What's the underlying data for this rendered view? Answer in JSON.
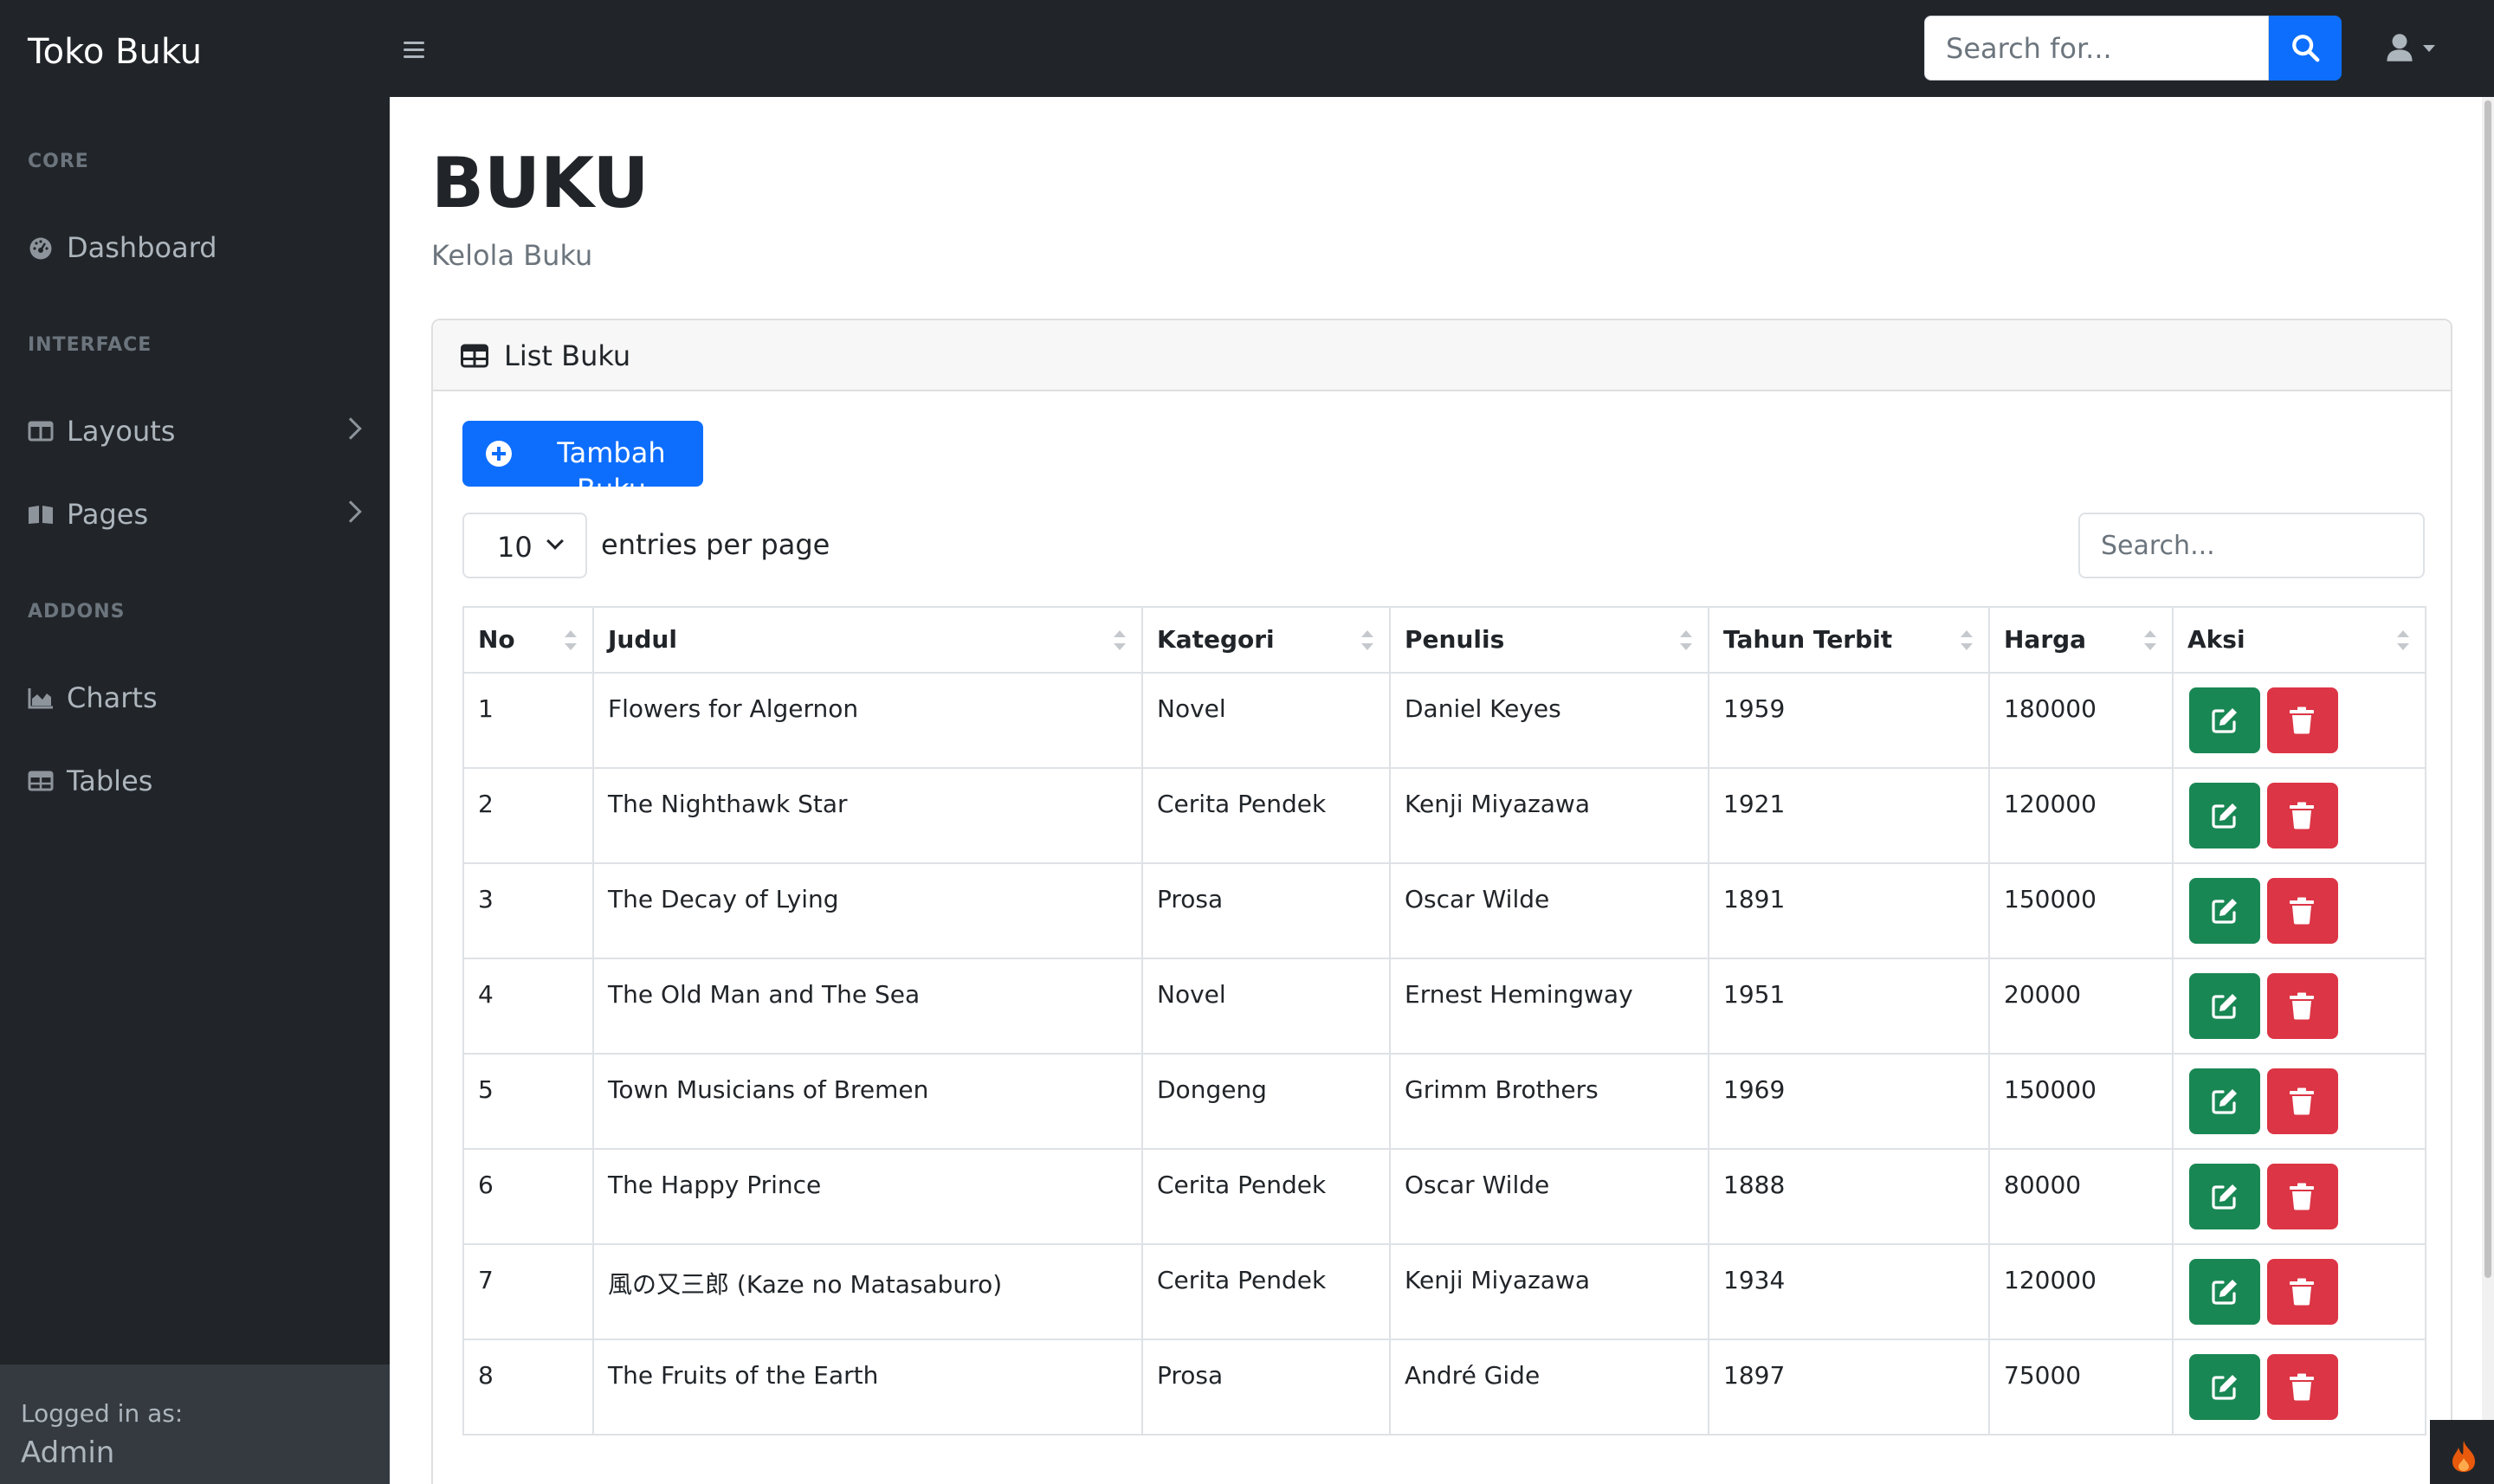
{
  "navbar": {
    "brand": "Toko Buku",
    "search_placeholder": "Search for..."
  },
  "sidebar": {
    "sections": [
      {
        "heading": "CORE",
        "items": [
          {
            "label": "Dashboard",
            "icon": "tachometer-icon"
          }
        ]
      },
      {
        "heading": "INTERFACE",
        "items": [
          {
            "label": "Layouts",
            "icon": "columns-icon"
          },
          {
            "label": "Pages",
            "icon": "book-open-icon"
          }
        ]
      },
      {
        "heading": "ADDONS",
        "items": [
          {
            "label": "Charts",
            "icon": "chart-area-icon"
          },
          {
            "label": "Tables",
            "icon": "table-icon"
          }
        ]
      }
    ],
    "footer": {
      "label": "Logged in as:",
      "user": "Admin"
    }
  },
  "page": {
    "title": "BUKU",
    "subtitle": "Kelola Buku"
  },
  "card": {
    "title": "List Buku",
    "add_button": "Tambah Buku",
    "per_page_value": "10",
    "per_page_label": "entries per page",
    "search_placeholder": "Search..."
  },
  "table": {
    "headers": [
      "No",
      "Judul",
      "Kategori",
      "Penulis",
      "Tahun Terbit",
      "Harga",
      "Aksi"
    ],
    "rows": [
      [
        "1",
        "Flowers for Algernon",
        "Novel",
        "Daniel Keyes",
        "1959",
        "180000"
      ],
      [
        "2",
        "The Nighthawk Star",
        "Cerita Pendek",
        "Kenji Miyazawa",
        "1921",
        "120000"
      ],
      [
        "3",
        "The Decay of Lying",
        "Prosa",
        "Oscar Wilde",
        "1891",
        "150000"
      ],
      [
        "4",
        "The Old Man and The Sea",
        "Novel",
        "Ernest Hemingway",
        "1951",
        "20000"
      ],
      [
        "5",
        "Town Musicians of Bremen",
        "Dongeng",
        "Grimm Brothers",
        "1969",
        "150000"
      ],
      [
        "6",
        "The Happy Prince",
        "Cerita Pendek",
        "Oscar Wilde",
        "1888",
        "80000"
      ],
      [
        "7",
        "風の又三郎 (Kaze no Matasaburo)",
        "Cerita Pendek",
        "Kenji Miyazawa",
        "1934",
        "120000"
      ],
      [
        "8",
        "The Fruits of the Earth",
        "Prosa",
        "André Gide",
        "1897",
        "75000"
      ]
    ]
  },
  "colors": {
    "dark": "#212529",
    "primary": "#0d6efd",
    "success": "#198754",
    "danger": "#dc3545"
  }
}
